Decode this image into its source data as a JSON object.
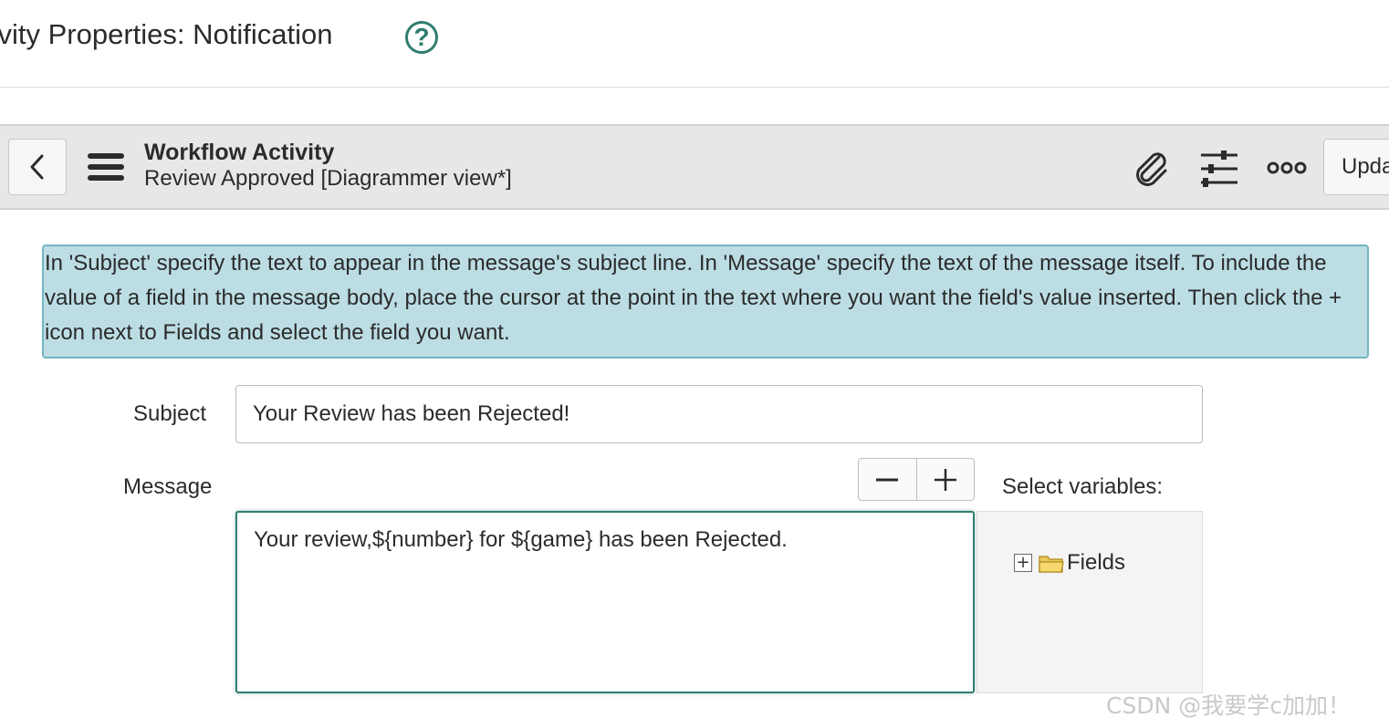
{
  "title_bar": {
    "title": "tivity Properties: Notification",
    "help_icon": "question-circle-icon"
  },
  "header": {
    "record_type": "Workflow Activity",
    "record_name": "Review Approved [Diagrammer view*]",
    "update_label": "Upda",
    "icons": [
      "chevron-left-icon",
      "hamburger-menu-icon",
      "paperclip-icon",
      "sliders-icon",
      "more-icon"
    ]
  },
  "info": {
    "lines": [
      "In 'Subject' specify the text to appear in the message's subject line. In 'Message' specify the text of the message itself. To include the",
      "value of a field in the message body, place the cursor at the point in the text where you want the field's value inserted. Then click the +",
      "icon next to Fields and select the field you want."
    ]
  },
  "form": {
    "subject_label": "Subject",
    "subject_value": "Your Review has been Rejected!",
    "message_label": "Message",
    "message_value": "Your review,${number} for ${game} has been Rejected.",
    "select_variables_label": "Select variables:",
    "tree": {
      "expand_symbol": "+",
      "node_label": "Fields",
      "icon": "folder-icon"
    }
  },
  "colors": {
    "accent": "#2f7e6e",
    "info_bg": "#bcdde4",
    "info_border": "#73b6c3",
    "header_bg": "#e6e7e8"
  },
  "watermark": "CSDN @我要学c加加！"
}
